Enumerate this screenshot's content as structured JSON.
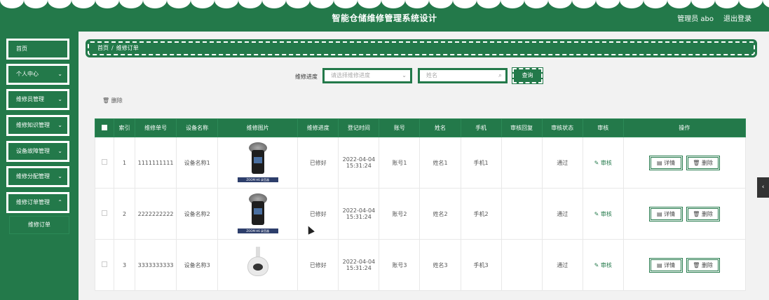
{
  "app": {
    "title": "智能仓储维修管理系统设计",
    "user": "管理员 abo",
    "logout": "退出登录"
  },
  "sidebar": {
    "items": [
      {
        "label": "首页",
        "chevron": false
      },
      {
        "label": "个人中心",
        "chevron": true
      },
      {
        "label": "维修员管理",
        "chevron": true
      },
      {
        "label": "维修知识管理",
        "chevron": true
      },
      {
        "label": "设备故障管理",
        "chevron": true
      },
      {
        "label": "维修分配管理",
        "chevron": true
      },
      {
        "label": "维修订单管理",
        "chevron": true
      }
    ],
    "submenu": {
      "label": "维修订单"
    }
  },
  "breadcrumb": {
    "home": "首页",
    "sep": "/",
    "current": "维修订单"
  },
  "search": {
    "label": "维修进度",
    "select_placeholder": "请选择维修进度",
    "name_placeholder": "姓名",
    "query_label": "查询"
  },
  "actions": {
    "delete_label": "删除"
  },
  "table": {
    "headers": [
      "索引",
      "维修单号",
      "设备名称",
      "维修图片",
      "维修进度",
      "登记时间",
      "账号",
      "姓名",
      "手机",
      "审核回复",
      "审核状态",
      "审核",
      "操作"
    ],
    "rows": [
      {
        "index": "1",
        "order_no": "1111111111",
        "device": "设备名称1",
        "image": "recorder",
        "image_caption": "ZOOM H6 录音器",
        "progress": "已修好",
        "date": "2022-04-04",
        "time": "15:31:24",
        "account": "账号1",
        "name": "姓名1",
        "phone": "手机1",
        "reply": "",
        "status": "通过",
        "audit": "审核",
        "detail": "详情",
        "delete": "删除"
      },
      {
        "index": "2",
        "order_no": "2222222222",
        "device": "设备名称2",
        "image": "recorder",
        "image_caption": "ZOOM H6 录音器",
        "progress": "已修好",
        "date": "2022-04-04",
        "time": "15:31:24",
        "account": "账号2",
        "name": "姓名2",
        "phone": "手机2",
        "reply": "",
        "status": "通过",
        "audit": "审核",
        "detail": "详情",
        "delete": "删除"
      },
      {
        "index": "3",
        "order_no": "3333333333",
        "device": "设备名称3",
        "image": "camera",
        "image_caption": "",
        "progress": "已修好",
        "date": "2022-04-04",
        "time": "15:31:24",
        "account": "账号3",
        "name": "姓名3",
        "phone": "手机3",
        "reply": "",
        "status": "通过",
        "audit": "审核",
        "detail": "详情",
        "delete": "删除"
      }
    ]
  },
  "colors": {
    "primary": "#23794a",
    "background": "#f2f2f2"
  },
  "icons": {
    "delete": "trash-icon",
    "search": "search-icon",
    "detail": "document-icon",
    "audit": "edit-icon",
    "scroll": "chevron-left-icon"
  }
}
